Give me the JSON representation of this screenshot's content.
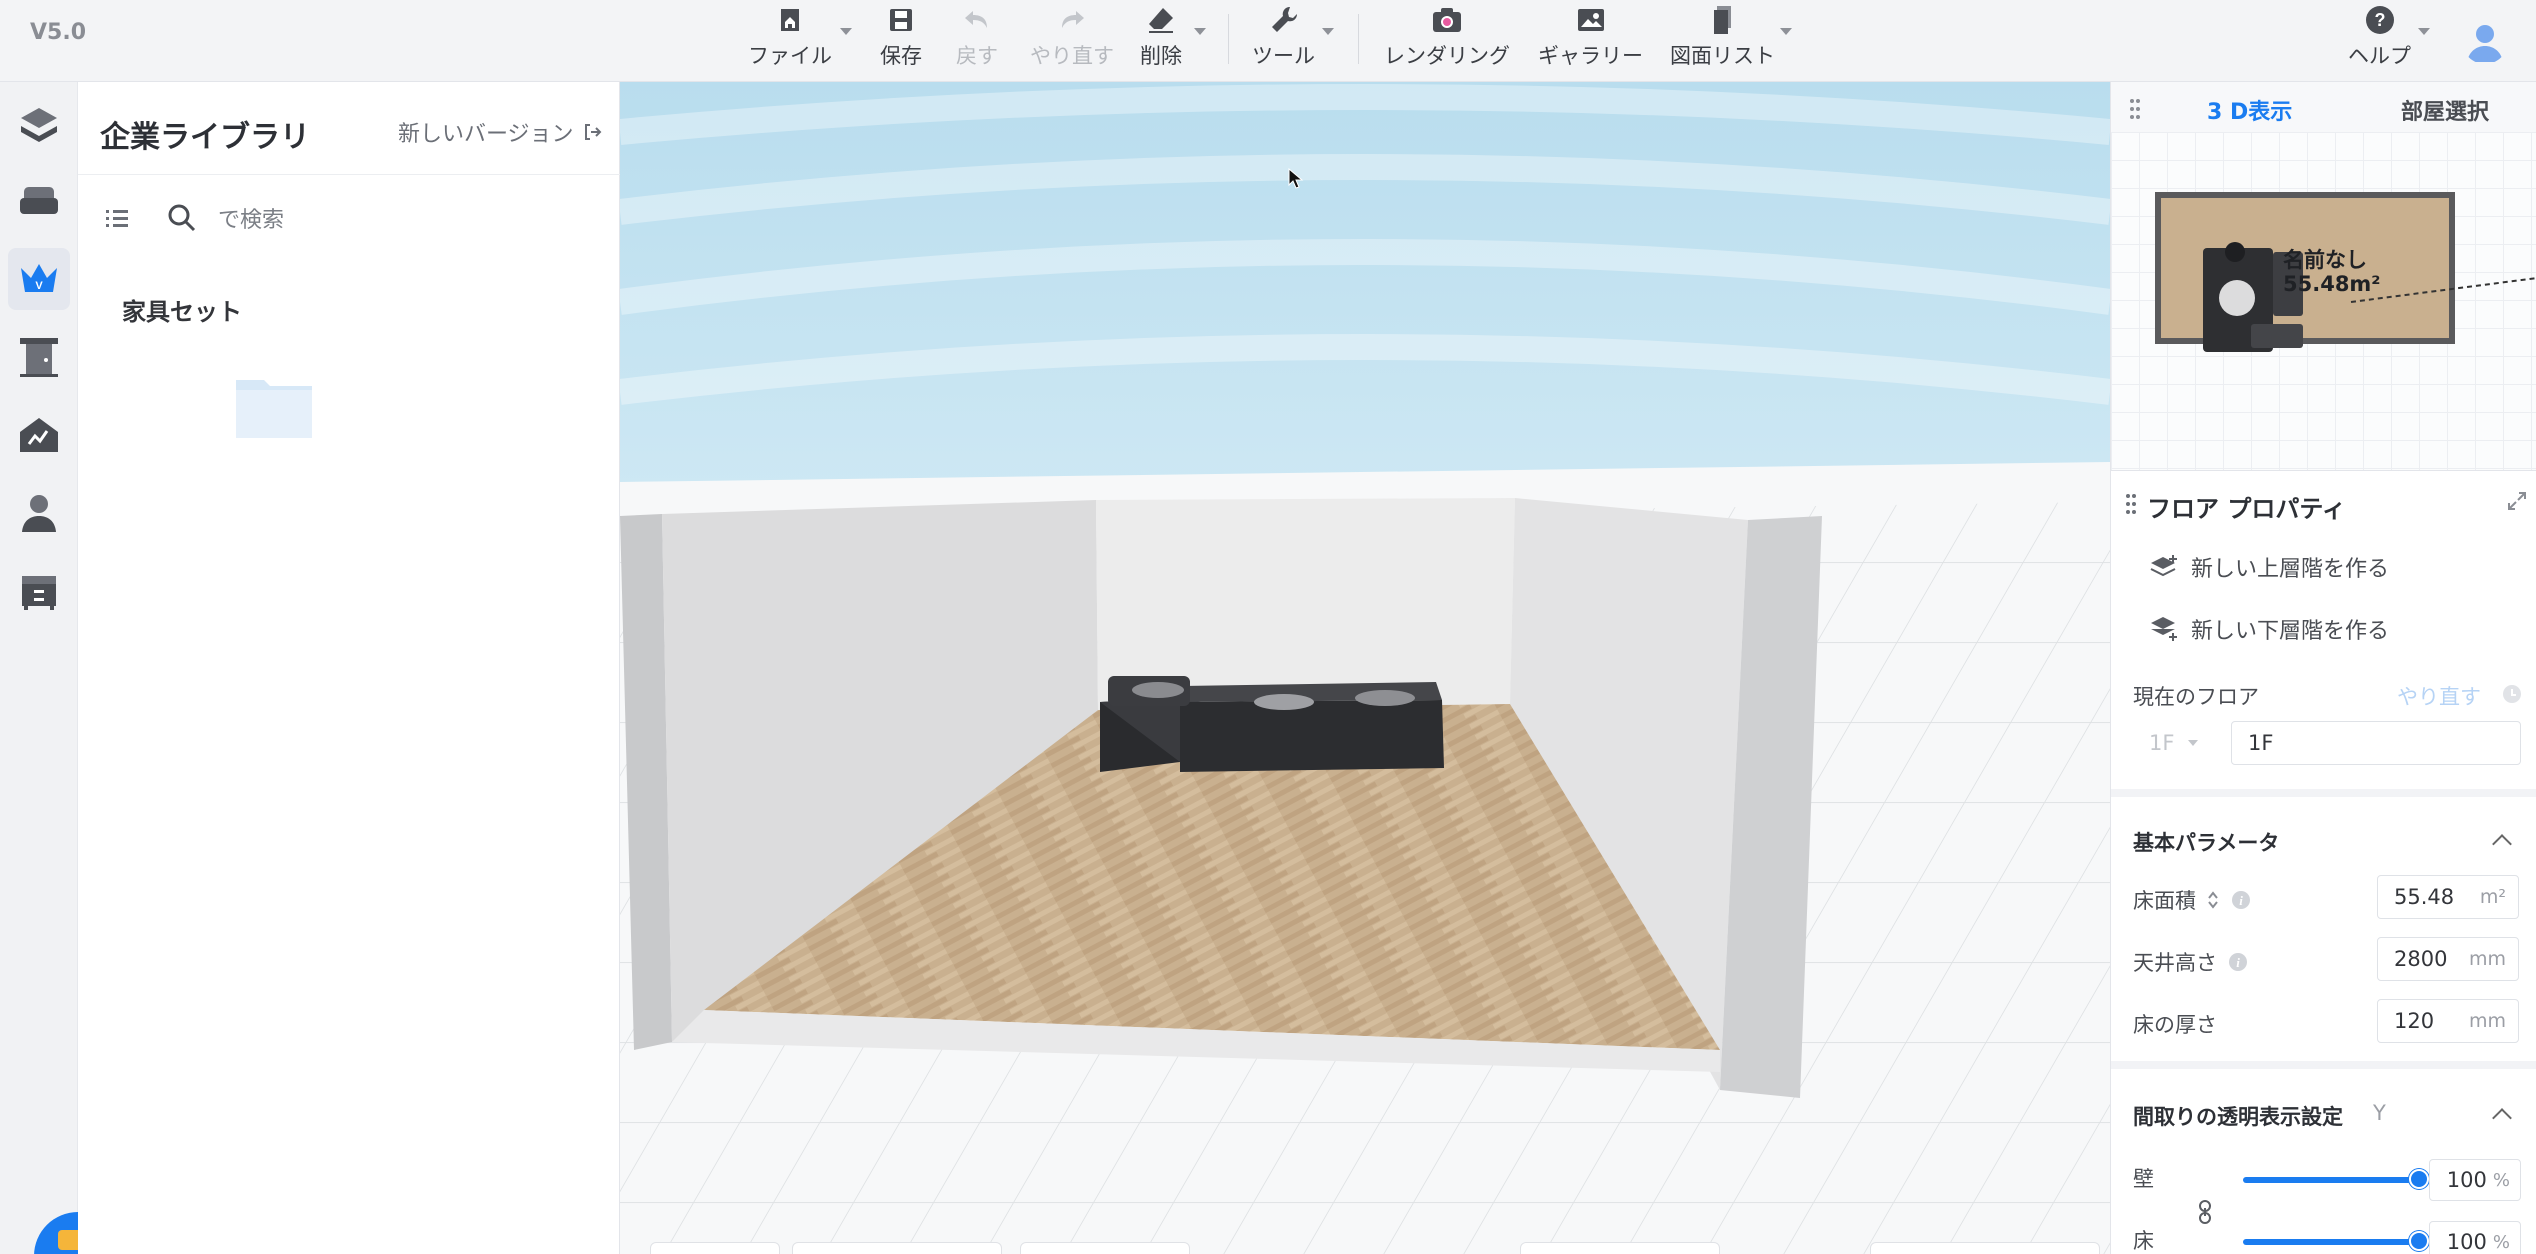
{
  "app": {
    "version": "V5.0"
  },
  "toolbar": {
    "file": "ファイル",
    "save": "保存",
    "undo": "戻す",
    "redo": "やり直す",
    "delete": "削除",
    "tools": "ツール",
    "render": "レンダリング",
    "gallery": "ギャラリー",
    "drawings": "図面リスト",
    "help": "ヘルプ"
  },
  "library": {
    "title": "企業ライブラリ",
    "new_version": "新しいバージョン",
    "search_placeholder": "で検索",
    "section": "家具セット"
  },
  "right_panel": {
    "tabs": [
      "3 D表示",
      "部屋選択"
    ],
    "active_tab": 0,
    "minimap": {
      "room_name": "名前なし",
      "room_area": "55.48m²"
    },
    "floor_props": {
      "title": "フロア プロパティ",
      "new_upper": "新しい上層階を作る",
      "new_lower": "新しい下層階を作る",
      "current_floor_label": "現在のフロア",
      "redo_link": "やり直す",
      "floor_select": "1F",
      "floor_name": "1F"
    },
    "basic_params": {
      "title": "基本パラメータ",
      "area_label": "床面積",
      "area_value": "55.48",
      "area_unit": "m²",
      "ceiling_label": "天井高さ",
      "ceiling_value": "2800",
      "ceiling_unit": "mm",
      "thickness_label": "床の厚さ",
      "thickness_value": "120",
      "thickness_unit": "mm"
    },
    "transparency": {
      "title": "間取りの透明表示設定",
      "shortcut": "Y",
      "wall_label": "壁",
      "wall_value": "100",
      "wall_level": 1.0,
      "floor_label": "床",
      "floor_value": "100",
      "floor_level": 1.0,
      "unit": "%"
    }
  },
  "colors": {
    "accent": "#1a7cf0",
    "floor_wood": "#c7ad8c",
    "sofa": "#2f3033"
  }
}
